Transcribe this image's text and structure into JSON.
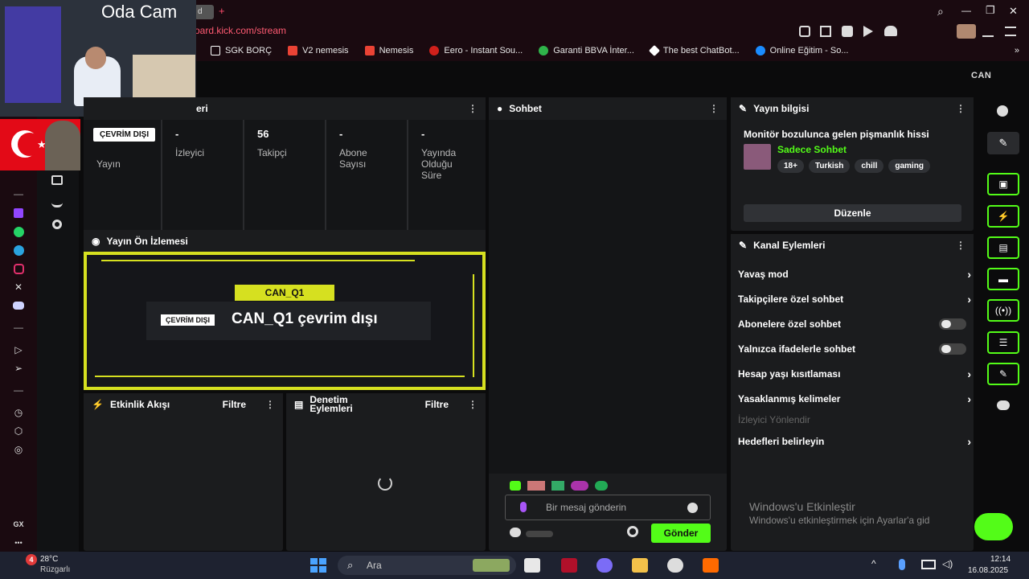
{
  "overlay": {
    "cam_label": "Oda Cam"
  },
  "browser": {
    "tab_partial": "d",
    "new_tab": "+",
    "url": "oard.kick.com/stream",
    "window_controls": {
      "search": "⌕",
      "minimize": "—",
      "restore": "❐",
      "close": "✕"
    },
    "bookmarks": [
      {
        "label": "SGK BORÇ",
        "color": "#ffffff"
      },
      {
        "label": "V2 nemesis",
        "color": "#ea4335"
      },
      {
        "label": "Nemesis",
        "color": "#ea4335"
      },
      {
        "label": "Eero - Instant Sou...",
        "color": "#d0201b"
      },
      {
        "label": "Garanti BBVA İnter...",
        "color": "#2fb34a"
      },
      {
        "label": "The best ChatBot...",
        "color": "#ffffff"
      },
      {
        "label": "Online Eğitim - So...",
        "color": "#1a8cff"
      }
    ],
    "more": "»"
  },
  "header": {
    "logo": "CAN"
  },
  "stats": {
    "title_partial": "eri",
    "status_badge": "ÇEVRİM DIŞI",
    "items": [
      {
        "value": "",
        "label": "Yayın"
      },
      {
        "value": "-",
        "label": "İzleyici"
      },
      {
        "value": "56",
        "label": "Takipçi"
      },
      {
        "value": "-",
        "label": "Abone Sayısı"
      },
      {
        "value": "-",
        "label": "Yayında Olduğu Süre"
      }
    ]
  },
  "preview": {
    "title": "Yayın Ön İzlemesi",
    "channel_tag": "CAN_Q1",
    "offline_badge": "ÇEVRİM DIŞI",
    "offline_text": "CAN_Q1 çevrim dışı"
  },
  "activity": {
    "title": "Etkinlik Akışı",
    "filter": "Filtre"
  },
  "moderation": {
    "title": "Denetim Eylemleri",
    "filter": "Filtre"
  },
  "chat": {
    "title": "Sohbet",
    "placeholder": "Bir mesaj gönderin",
    "send": "Gönder"
  },
  "stream_info": {
    "title": "Yayın bilgisi",
    "stream_title": "Monitör bozulunca gelen pişmanlık hissi",
    "category": "Sadece Sohbet",
    "tags": [
      "18+",
      "Turkish",
      "chill",
      "gaming"
    ],
    "edit_button": "Düzenle"
  },
  "channel_actions": {
    "title": "Kanal Eylemleri",
    "items": [
      {
        "label": "Yavaş mod",
        "control": "chevron"
      },
      {
        "label": "Takipçilere özel sohbet",
        "control": "chevron"
      },
      {
        "label": "Abonelere özel sohbet",
        "control": "toggle"
      },
      {
        "label": "Yalnızca ifadelerle sohbet",
        "control": "toggle"
      },
      {
        "label": "Hesap yaşı kısıtlaması",
        "control": "chevron"
      },
      {
        "label": "Yasaklanmış kelimeler",
        "control": "chevron"
      },
      {
        "label": "İzleyici Yönlendir",
        "control": "none"
      },
      {
        "label": "Hedefleri belirleyin",
        "control": "chevron"
      }
    ]
  },
  "watermark": {
    "line1": "Windows'u Etkinleştir",
    "line2": "Windows'u etkinleştirmek için Ayarlar'a gid"
  },
  "leftbar": {
    "gx": "GX",
    "more": "•••"
  },
  "taskbar": {
    "notif_count": "4",
    "weather_temp": "28°C",
    "weather_desc": "Rüzgarlı",
    "search": "Ara",
    "time": "12:14",
    "date": "16.08.2025"
  },
  "colors": {
    "accent": "#53fc18",
    "panel": "#1b1c1e",
    "background": "#0b0b0c",
    "preview_border": "#d6e020"
  }
}
